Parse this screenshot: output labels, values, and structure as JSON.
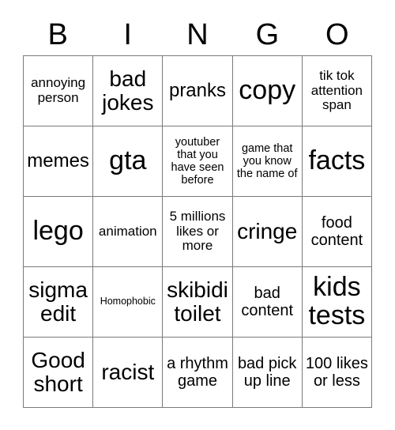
{
  "header": {
    "letters": [
      "B",
      "I",
      "N",
      "G",
      "O"
    ]
  },
  "grid": {
    "rows": 5,
    "columns": 5,
    "border_color": "#7a7a7a",
    "background_color": "#ffffff",
    "text_color": "#000000",
    "cells": [
      {
        "text": "annoying person",
        "size": "s"
      },
      {
        "text": "bad jokes",
        "size": "xl"
      },
      {
        "text": "pranks",
        "size": "l"
      },
      {
        "text": "copy",
        "size": "xxl"
      },
      {
        "text": "tik tok attention span",
        "size": "s"
      },
      {
        "text": "memes",
        "size": "l"
      },
      {
        "text": "gta",
        "size": "xxl"
      },
      {
        "text": "youtuber that you have seen before",
        "size": "xs"
      },
      {
        "text": "game that you know the name of",
        "size": "xs"
      },
      {
        "text": "facts",
        "size": "xxl"
      },
      {
        "text": "lego",
        "size": "xxl"
      },
      {
        "text": "animation",
        "size": "s"
      },
      {
        "text": "5 millions likes or more",
        "size": "s"
      },
      {
        "text": "cringe",
        "size": "xl"
      },
      {
        "text": "food content",
        "size": "m"
      },
      {
        "text": "sigma edit",
        "size": "xl"
      },
      {
        "text": "Homophobic",
        "size": "xxs"
      },
      {
        "text": "skibidi toilet",
        "size": "xl"
      },
      {
        "text": "bad content",
        "size": "m"
      },
      {
        "text": "kids tests",
        "size": "xxl"
      },
      {
        "text": "Good short",
        "size": "xl"
      },
      {
        "text": "racist",
        "size": "xl"
      },
      {
        "text": "a rhythm game",
        "size": "m"
      },
      {
        "text": "bad pick up line",
        "size": "m"
      },
      {
        "text": "100 likes or less",
        "size": "m"
      }
    ]
  }
}
